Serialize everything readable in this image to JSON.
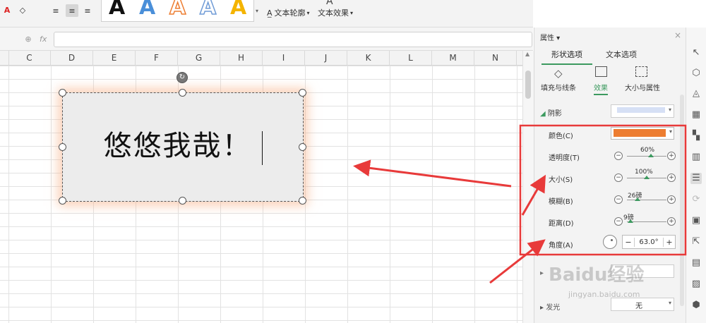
{
  "ribbon": {
    "art_letter": "A",
    "text_outline_label": "文本轮廓",
    "text_effect_label": "文本效果"
  },
  "formula_bar": {
    "fx_label": "fx",
    "value": ""
  },
  "columns": [
    "C",
    "D",
    "E",
    "F",
    "G",
    "H",
    "I",
    "J",
    "K",
    "L",
    "M",
    "N"
  ],
  "textbox": {
    "text": "悠悠我哉！"
  },
  "panel": {
    "title": "属性",
    "tabs": [
      {
        "label": "形状选项",
        "active": true
      },
      {
        "label": "文本选项",
        "active": false
      }
    ],
    "subtabs": [
      {
        "label": "填充与线条"
      },
      {
        "label": "效果",
        "active": true
      },
      {
        "label": "大小与属性"
      }
    ],
    "shadow_section": "阴影",
    "rows": {
      "color": {
        "label": "颜色(C)",
        "value_color": "#ed7d31"
      },
      "transparency": {
        "label": "透明度(T)",
        "value": "60%",
        "fraction": 0.6
      },
      "size": {
        "label": "大小(S)",
        "value": "100%",
        "fraction": 0.5
      },
      "blur": {
        "label": "模糊(B)",
        "value": "26磅",
        "fraction": 0.26
      },
      "distance": {
        "label": "距离(D)",
        "value": "9磅",
        "fraction": 0.09
      },
      "angle": {
        "label": "角度(A)",
        "value": "63.0°"
      }
    },
    "glow_section": "发光",
    "glow_value": "无",
    "watermark": "Baidu经验",
    "watermark_sub": "jingyan.baidu.com"
  },
  "colors": {
    "accent_green": "#3c9a5f",
    "highlight_red": "#e83a3a",
    "shadow_orange": "#ed7d31"
  }
}
